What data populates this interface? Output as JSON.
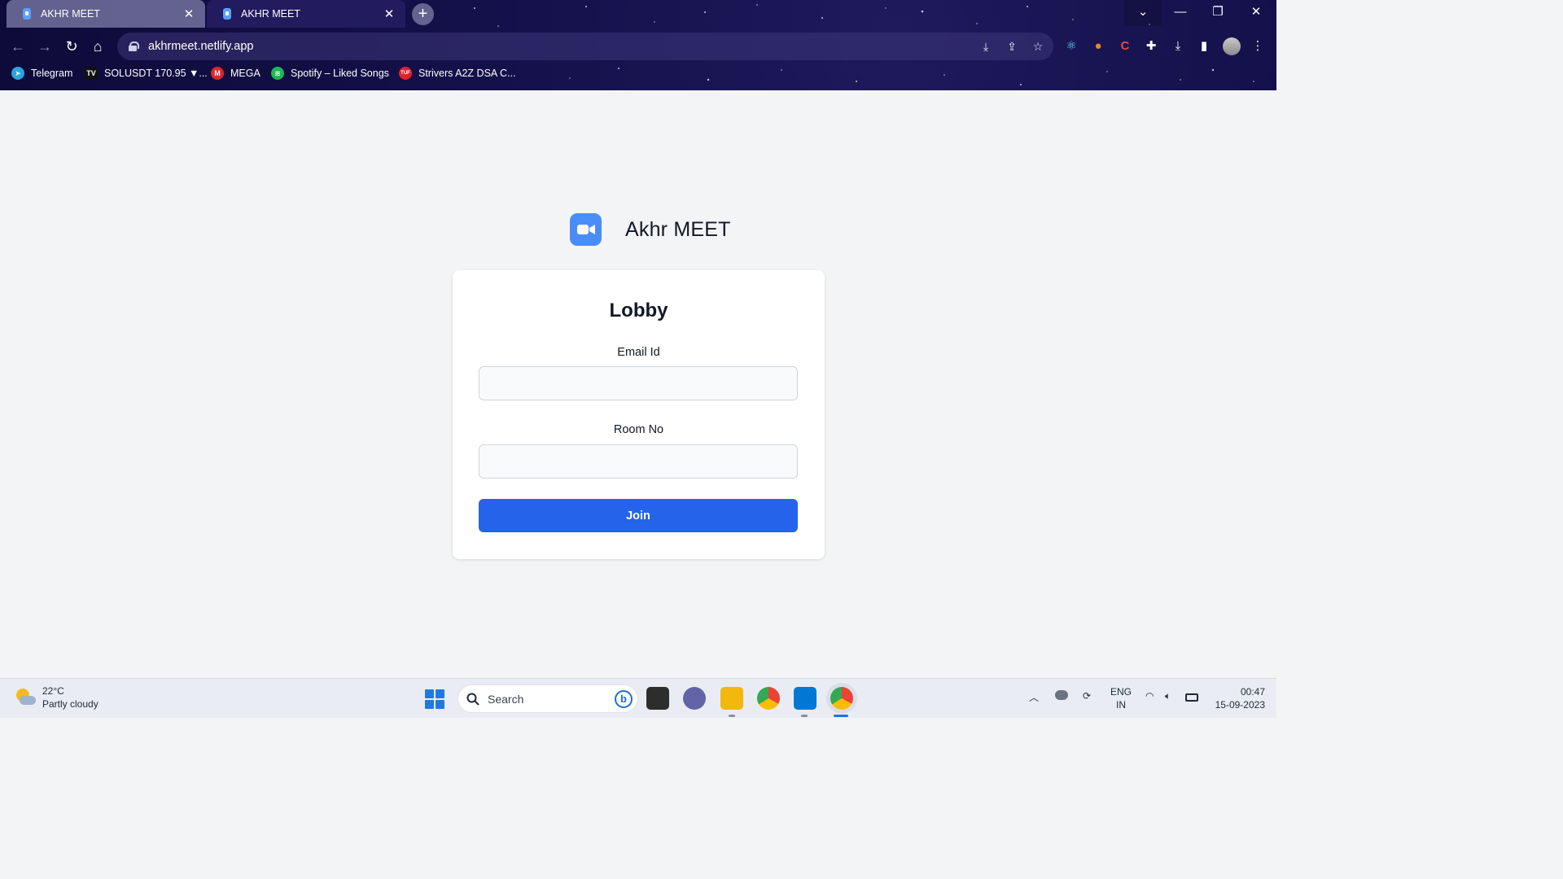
{
  "browser": {
    "tabs": [
      {
        "title": "AKHR MEET",
        "active": false
      },
      {
        "title": "AKHR MEET",
        "active": true
      }
    ],
    "new_tab_symbol": "+",
    "url": "akhrmeet.netlify.app",
    "bookmarks": [
      {
        "label": "Telegram",
        "icon": "telegram-icon",
        "color": "#2aa3e0"
      },
      {
        "label": "SOLUSDT 170.95 ▼...",
        "icon": "tradingview-icon",
        "color": "#111111"
      },
      {
        "label": "MEGA",
        "icon": "mega-icon",
        "color": "#d9272e"
      },
      {
        "label": "Spotify – Liked Songs",
        "icon": "spotify-icon",
        "color": "#1db954"
      },
      {
        "label": "Strivers A2Z DSA C...",
        "icon": "tuf-icon",
        "color": "#e0222b"
      }
    ]
  },
  "app": {
    "name": "Akhr MEET",
    "logo_color": "#4b8df8",
    "card": {
      "title": "Lobby",
      "email_label": "Email Id",
      "email_value": "",
      "room_label": "Room No",
      "room_value": "",
      "join_label": "Join",
      "join_color": "#2563eb"
    }
  },
  "taskbar": {
    "weather_temp": "22°C",
    "weather_desc": "Partly cloudy",
    "search_placeholder": "Search",
    "lang_top": "ENG",
    "lang_bottom": "IN",
    "time": "00:47",
    "date": "15-09-2023"
  }
}
